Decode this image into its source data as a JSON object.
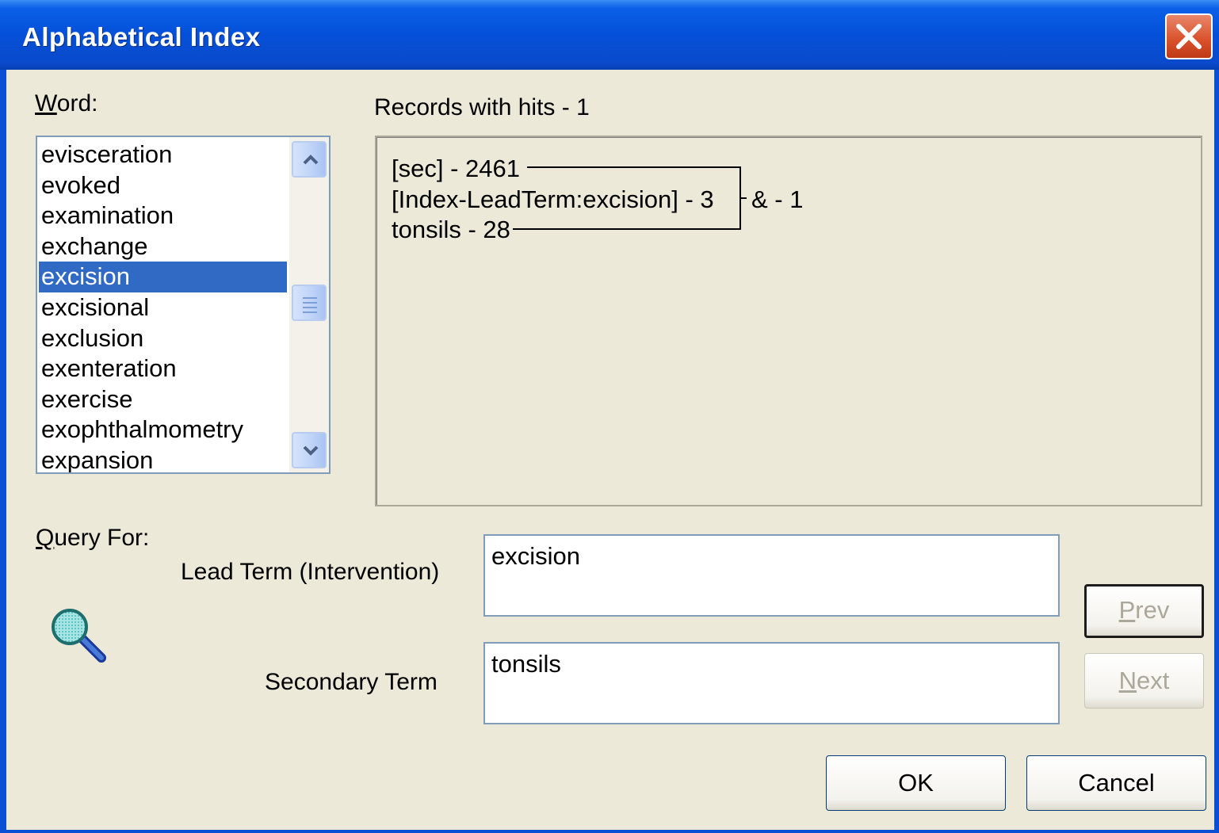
{
  "window": {
    "title": "Alphabetical Index",
    "close_icon": "close-icon"
  },
  "word": {
    "label_underlined": "W",
    "label_rest": "ord:",
    "items": [
      {
        "label": "evisceration"
      },
      {
        "label": "evoked"
      },
      {
        "label": "examination"
      },
      {
        "label": "exchange"
      },
      {
        "label": "excision",
        "selected": true
      },
      {
        "label": "excisional"
      },
      {
        "label": "exclusion"
      },
      {
        "label": "exenteration"
      },
      {
        "label": "exercise"
      },
      {
        "label": "exophthalmometry"
      },
      {
        "label": "expansion"
      }
    ]
  },
  "results": {
    "header": "Records with hits - 1",
    "lines": [
      "[sec] - 2461",
      "[Index-LeadTerm:excision] - 3",
      "tonsils - 28"
    ],
    "combined": "& - 1"
  },
  "query": {
    "label_underlined": "Q",
    "label_rest": "uery For:",
    "lead_term_label": "Lead Term (Intervention)",
    "lead_term_value": "excision",
    "secondary_term_label": "Secondary Term",
    "secondary_term_value": "tonsils",
    "icon": "magnifier-icon"
  },
  "buttons": {
    "prev_underlined": "P",
    "prev_rest": "rev",
    "next_underlined": "N",
    "next_rest": "ext",
    "ok": "OK",
    "cancel": "Cancel"
  },
  "colors": {
    "titlebar": "#0550D8",
    "dialog_bg": "#ECE9D8",
    "selection": "#316AC5"
  }
}
